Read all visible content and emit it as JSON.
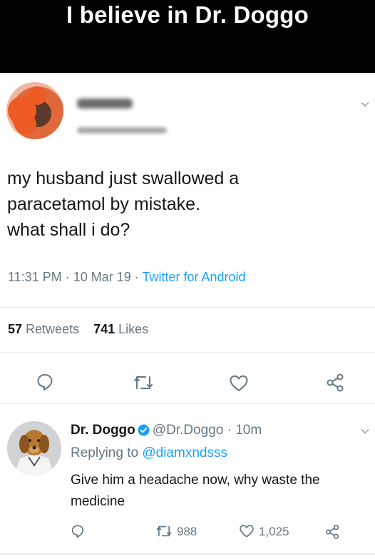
{
  "banner": {
    "title": "I believe in Dr. Doggo"
  },
  "tweet": {
    "lines": [
      "my husband just swallowed a",
      "paracetamol by mistake.",
      "what shall i do?"
    ],
    "time": "11:31 PM",
    "date": "10 Mar 19",
    "source": "Twitter for Android",
    "retweet_count": "57",
    "retweet_label": "Retweets",
    "like_count": "741",
    "like_label": "Likes"
  },
  "reply": {
    "name": "Dr. Doggo",
    "handle": "@Dr.Doggo",
    "time": "10m",
    "replying_prefix": "Replying to",
    "replying_to": "@diamxndsss",
    "lines": [
      "Give him a headache now, why waste the",
      "medicine"
    ],
    "retweets": "988",
    "likes": "1,025"
  },
  "icons": {
    "reply": "reply-icon",
    "retweet": "retweet-icon",
    "like": "heart-icon",
    "share": "share-icon",
    "menu": "chevron-down-icon",
    "verified": "verified-badge-icon"
  },
  "colors": {
    "link": "#1da1f2",
    "muted": "#657786",
    "text": "#14171a"
  }
}
